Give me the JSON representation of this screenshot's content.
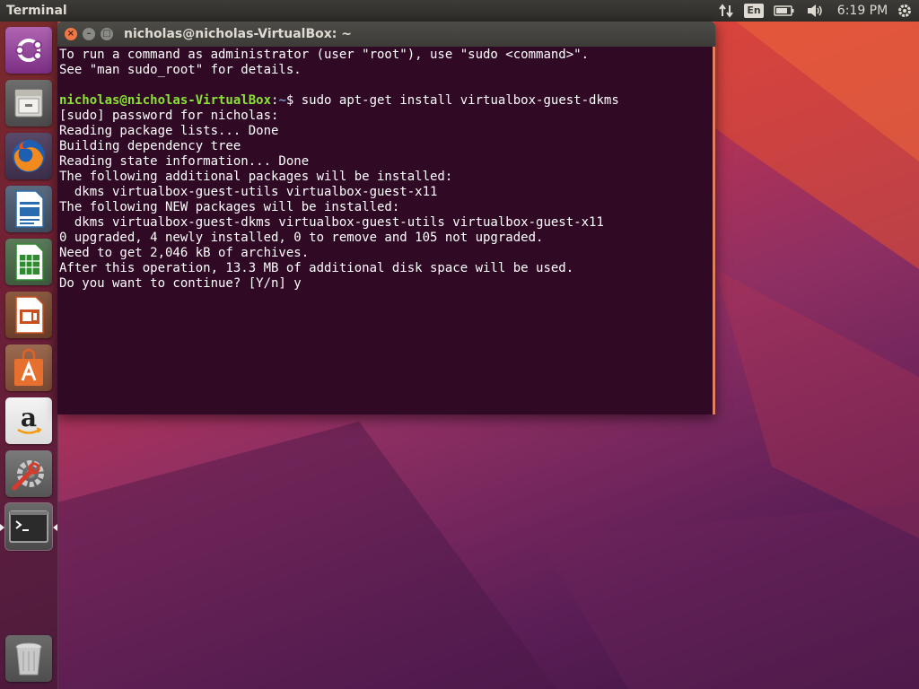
{
  "panel": {
    "app_title": "Terminal",
    "keyboard_layout": "En",
    "clock": "6:19 PM",
    "icons": [
      "network-arrows-icon",
      "keyboard-layout-indicator",
      "battery-icon",
      "volume-icon",
      "gear-icon"
    ]
  },
  "launcher": {
    "items": [
      {
        "name": "dash-home",
        "icon": "ubuntu-logo-icon"
      },
      {
        "name": "files",
        "icon": "file-cabinet-icon"
      },
      {
        "name": "firefox",
        "icon": "firefox-icon"
      },
      {
        "name": "libreoffice-writer",
        "icon": "writer-document-icon"
      },
      {
        "name": "libreoffice-calc",
        "icon": "calc-spreadsheet-icon"
      },
      {
        "name": "libreoffice-impress",
        "icon": "impress-presentation-icon"
      },
      {
        "name": "software-center",
        "icon": "shopping-bag-icon"
      },
      {
        "name": "amazon",
        "icon": "amazon-icon"
      },
      {
        "name": "system-settings",
        "icon": "settings-wrench-icon"
      },
      {
        "name": "terminal",
        "icon": "terminal-icon",
        "active": true
      },
      {
        "name": "trash",
        "icon": "trash-icon"
      }
    ]
  },
  "window": {
    "title": "nicholas@nicholas-VirtualBox: ~",
    "colors": {
      "background": "#300a24",
      "prompt_user": "#8ae234",
      "prompt_path": "#729fcf",
      "text": "#ffffff"
    }
  },
  "terminal": {
    "line1": "To run a command as administrator (user \"root\"), use \"sudo <command>\".",
    "line2": "See \"man sudo_root\" for details.",
    "prompt_user": "nicholas@nicholas-VirtualBox",
    "prompt_sep": ":",
    "prompt_path": "~",
    "prompt_command": "$ sudo apt-get install virtualbox-guest-dkms",
    "line3": "[sudo] password for nicholas:",
    "line4": "Reading package lists... Done",
    "line5": "Building dependency tree",
    "line6": "Reading state information... Done",
    "line7": "The following additional packages will be installed:",
    "line8": "  dkms virtualbox-guest-utils virtualbox-guest-x11",
    "line9": "The following NEW packages will be installed:",
    "line10": "  dkms virtualbox-guest-dkms virtualbox-guest-utils virtualbox-guest-x11",
    "line11": "0 upgraded, 4 newly installed, 0 to remove and 105 not upgraded.",
    "line12": "Need to get 2,046 kB of archives.",
    "line13": "After this operation, 13.3 MB of additional disk space will be used.",
    "line14": "Do you want to continue? [Y/n] y"
  }
}
